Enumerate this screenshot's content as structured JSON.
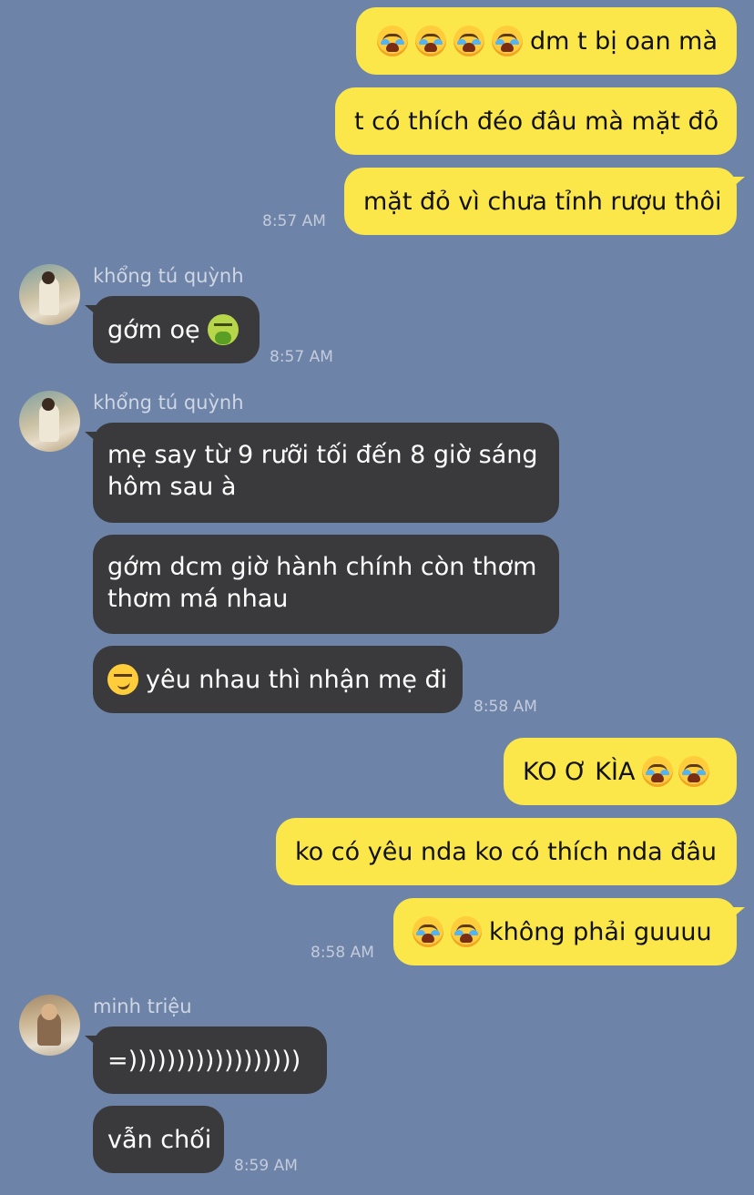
{
  "colors": {
    "background": "#6d83a7",
    "my_bubble": "#fbe74a",
    "their_bubble": "#3a3a3c"
  },
  "messages": [
    {
      "from": "me",
      "text": "dm t bị oan mà",
      "emoji_prefix": [
        "loudly-crying-face",
        "loudly-crying-face",
        "loudly-crying-face",
        "loudly-crying-face"
      ]
    },
    {
      "from": "me",
      "text": "t có thích đéo đâu mà mặt đỏ"
    },
    {
      "from": "me",
      "text": "mặt đỏ vì chưa tỉnh rượu thôi",
      "time": "8:57 AM"
    },
    {
      "from": "khổng tú quỳnh",
      "sender": "khổng tú quỳnh",
      "text": "gớm oẹ",
      "emoji_suffix": [
        "face-vomiting"
      ],
      "time": "8:57 AM"
    },
    {
      "from": "khổng tú quỳnh",
      "sender": "khổng tú quỳnh",
      "text": "mẹ say từ 9 rưỡi tối đến 8 giờ sáng hôm sau à"
    },
    {
      "from": "khổng tú quỳnh",
      "text": "gớm dcm giờ hành chính còn thơm thơm má nhau"
    },
    {
      "from": "khổng tú quỳnh",
      "text": "yêu nhau thì nhận mẹ đi",
      "emoji_prefix": [
        "smirking-face"
      ],
      "time": "8:58 AM"
    },
    {
      "from": "me",
      "text": "KO Ơ KÌA",
      "emoji_suffix": [
        "loudly-crying-face",
        "loudly-crying-face"
      ]
    },
    {
      "from": "me",
      "text": "ko có yêu nda ko có thích nda đâu"
    },
    {
      "from": "me",
      "text": "không phải guuuu",
      "emoji_prefix": [
        "loudly-crying-face",
        "loudly-crying-face"
      ],
      "time": "8:58 AM"
    },
    {
      "from": "minh triệu",
      "sender": "minh triệu",
      "text": "=))))))))))))))))))"
    },
    {
      "from": "minh triệu",
      "text": "vẫn chối",
      "time": "8:59 AM"
    }
  ]
}
